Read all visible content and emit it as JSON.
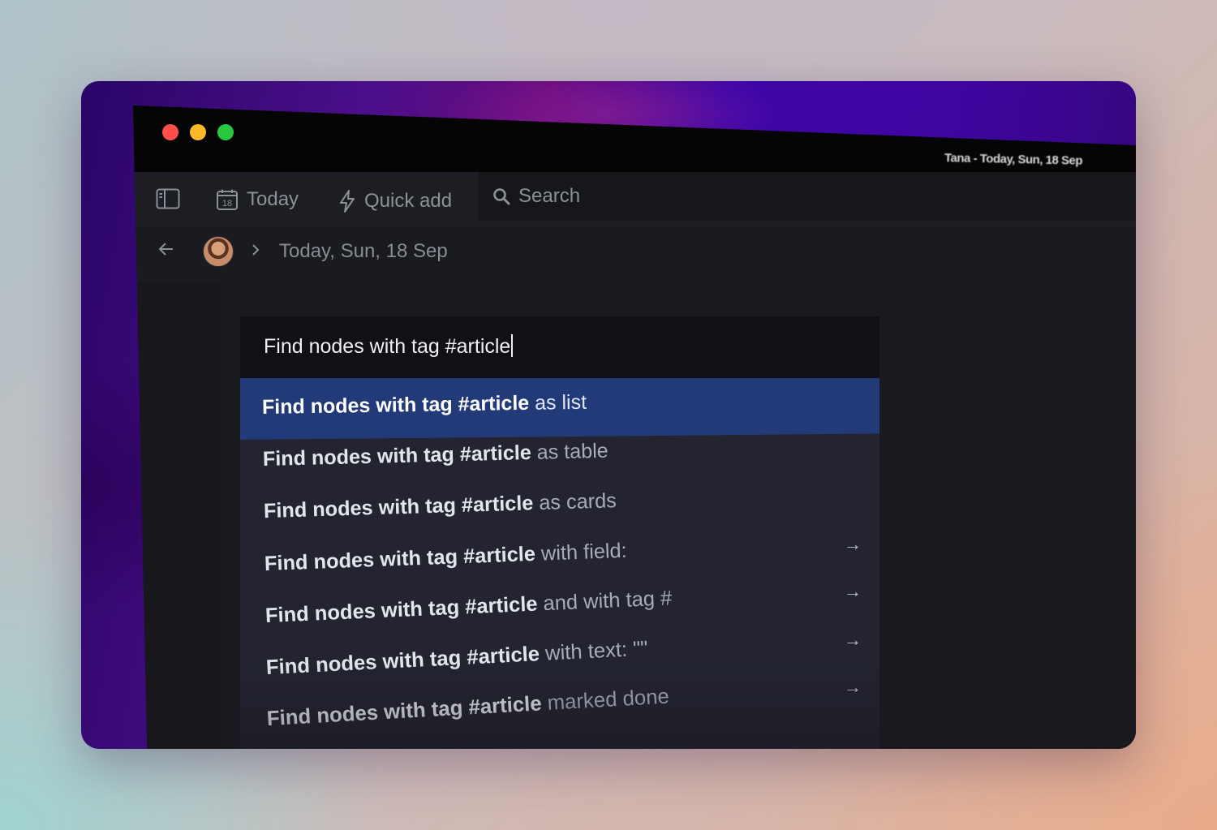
{
  "window": {
    "title": "Tana - Today, Sun, 18 Sep"
  },
  "toolbar": {
    "today_label": "Today",
    "today_date": "18",
    "quick_add_label": "Quick add",
    "search_label": "Search"
  },
  "breadcrumb": {
    "current": "Today, Sun, 18 Sep"
  },
  "palette": {
    "query": "Find nodes with tag #article",
    "options": [
      {
        "bold": "Find nodes with tag #article",
        "rest": " as list",
        "arrow": "",
        "selected": true
      },
      {
        "bold": "Find nodes with tag #article",
        "rest": " as table",
        "arrow": ""
      },
      {
        "bold": "Find nodes with tag #article",
        "rest": " as cards",
        "arrow": ""
      },
      {
        "bold": "Find nodes with tag #article",
        "rest": " with field:",
        "arrow": "→"
      },
      {
        "bold": "Find nodes with tag #article",
        "rest": " and with tag #",
        "arrow": "→"
      },
      {
        "bold": "Find nodes with tag #article",
        "rest": " with text: \"\"",
        "arrow": "→"
      },
      {
        "bold": "Find nodes with tag #article",
        "rest": " marked done",
        "arrow": "→"
      }
    ]
  },
  "colors": {
    "accent_selected": "#233a78",
    "traffic_red": "#ff4f4a",
    "traffic_yellow": "#fbb829",
    "traffic_green": "#27c840"
  }
}
